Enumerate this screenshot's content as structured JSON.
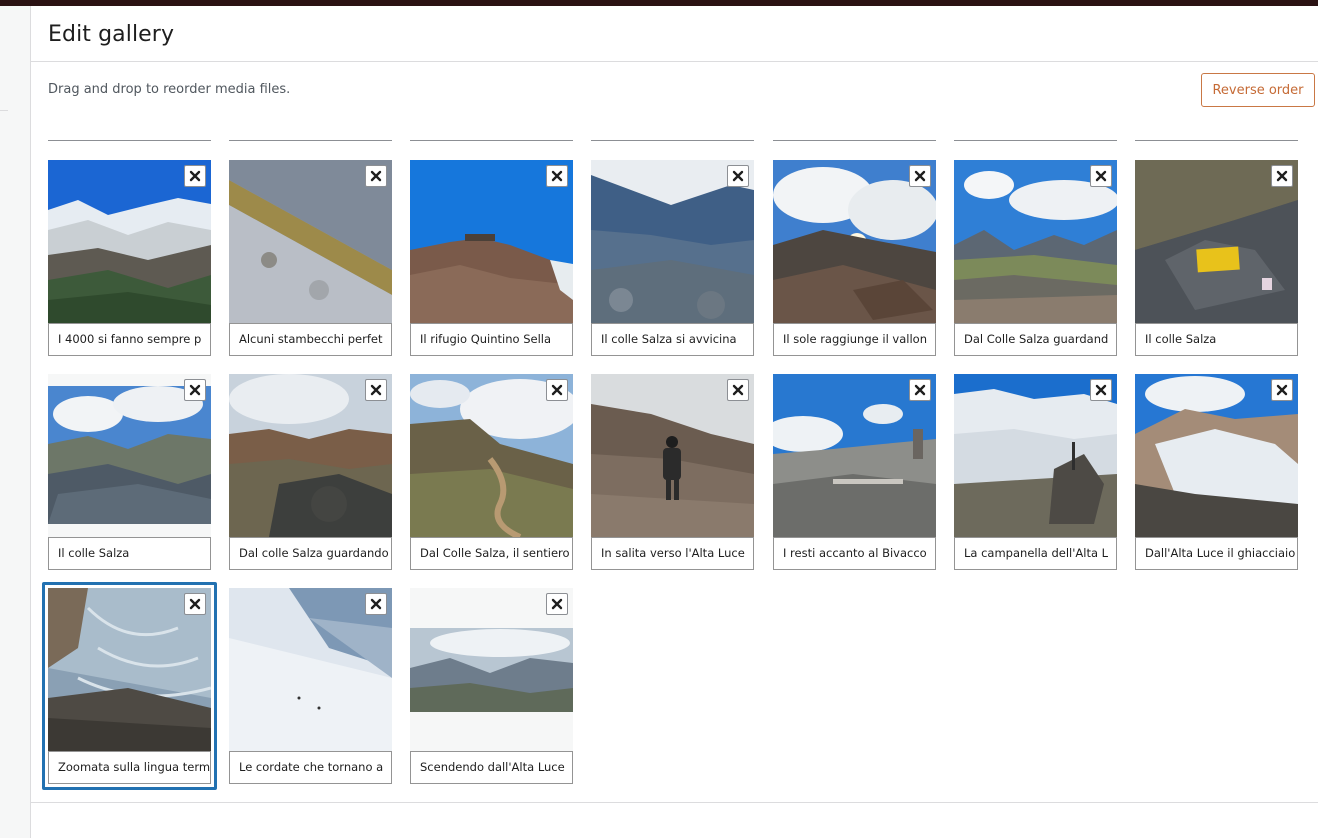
{
  "page": {
    "title": "Edit gallery"
  },
  "toolbar": {
    "instructions": "Drag and drop to reorder media files.",
    "reverse_label": "Reverse order"
  },
  "gallery": {
    "items": [
      {
        "caption": "I 4000 si fanno sempre p"
      },
      {
        "caption": "Alcuni stambecchi perfet"
      },
      {
        "caption": "Il rifugio Quintino Sella"
      },
      {
        "caption": "Il colle Salza si avvicina"
      },
      {
        "caption": "Il sole raggiunge il vallon"
      },
      {
        "caption": "Dal Colle Salza guardand"
      },
      {
        "caption": "Il colle Salza"
      },
      {
        "caption": "Il colle Salza"
      },
      {
        "caption": "Dal colle Salza guardando"
      },
      {
        "caption": "Dal Colle Salza, il sentiero"
      },
      {
        "caption": "In salita verso l'Alta Luce"
      },
      {
        "caption": "I resti accanto al Bivacco"
      },
      {
        "caption": "La campanella dell'Alta L"
      },
      {
        "caption": "Dall'Alta Luce il ghiacciaio"
      },
      {
        "caption": "Zoomata sulla lingua term"
      },
      {
        "caption": "Le cordate che tornano a"
      },
      {
        "caption": "Scendendo dall'Alta Luce"
      }
    ]
  },
  "icons": {
    "remove": "close-icon"
  },
  "colors": {
    "accent": "#2271b1",
    "reverse_button": "#c56a35",
    "top_bar": "#2b1213"
  }
}
